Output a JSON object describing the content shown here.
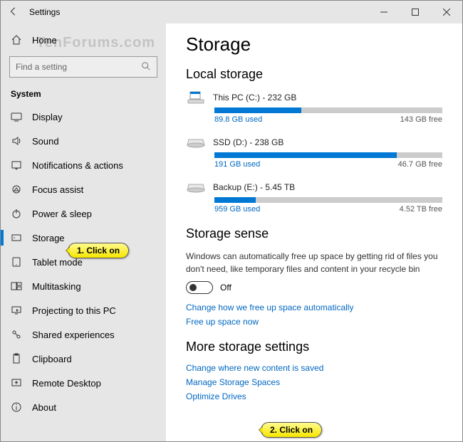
{
  "window_title": "Settings",
  "watermark": "TenForums.com",
  "home_label": "Home",
  "search": {
    "placeholder": "Find a setting"
  },
  "section_label": "System",
  "nav": [
    {
      "icon": "display",
      "label": "Display"
    },
    {
      "icon": "sound",
      "label": "Sound"
    },
    {
      "icon": "notif",
      "label": "Notifications & actions"
    },
    {
      "icon": "focus",
      "label": "Focus assist"
    },
    {
      "icon": "power",
      "label": "Power & sleep"
    },
    {
      "icon": "storage",
      "label": "Storage",
      "selected": true
    },
    {
      "icon": "tablet",
      "label": "Tablet mode"
    },
    {
      "icon": "multi",
      "label": "Multitasking"
    },
    {
      "icon": "project",
      "label": "Projecting to this PC"
    },
    {
      "icon": "shared",
      "label": "Shared experiences"
    },
    {
      "icon": "clipboard",
      "label": "Clipboard"
    },
    {
      "icon": "remote",
      "label": "Remote Desktop"
    },
    {
      "icon": "about",
      "label": "About"
    }
  ],
  "page_title": "Storage",
  "local_heading": "Local storage",
  "drives": [
    {
      "name": "This PC (C:) - 232 GB",
      "used": "89.8 GB used",
      "free": "143 GB free",
      "pct": 38
    },
    {
      "name": "SSD (D:) - 238 GB",
      "used": "191 GB used",
      "free": "46.7 GB free",
      "pct": 80
    },
    {
      "name": "Backup (E:) - 5.45 TB",
      "used": "959 GB used",
      "free": "4.52 TB free",
      "pct": 18
    }
  ],
  "sense_heading": "Storage sense",
  "sense_text": "Windows can automatically free up space by getting rid of files you don't need, like temporary files and content in your recycle bin",
  "toggle_state": "Off",
  "sense_links": [
    "Change how we free up space automatically",
    "Free up space now"
  ],
  "more_heading": "More storage settings",
  "more_links": [
    "Change where new content is saved",
    "Manage Storage Spaces",
    "Optimize Drives"
  ],
  "callouts": {
    "c1": "1. Click on",
    "c2": "2. Click on"
  }
}
